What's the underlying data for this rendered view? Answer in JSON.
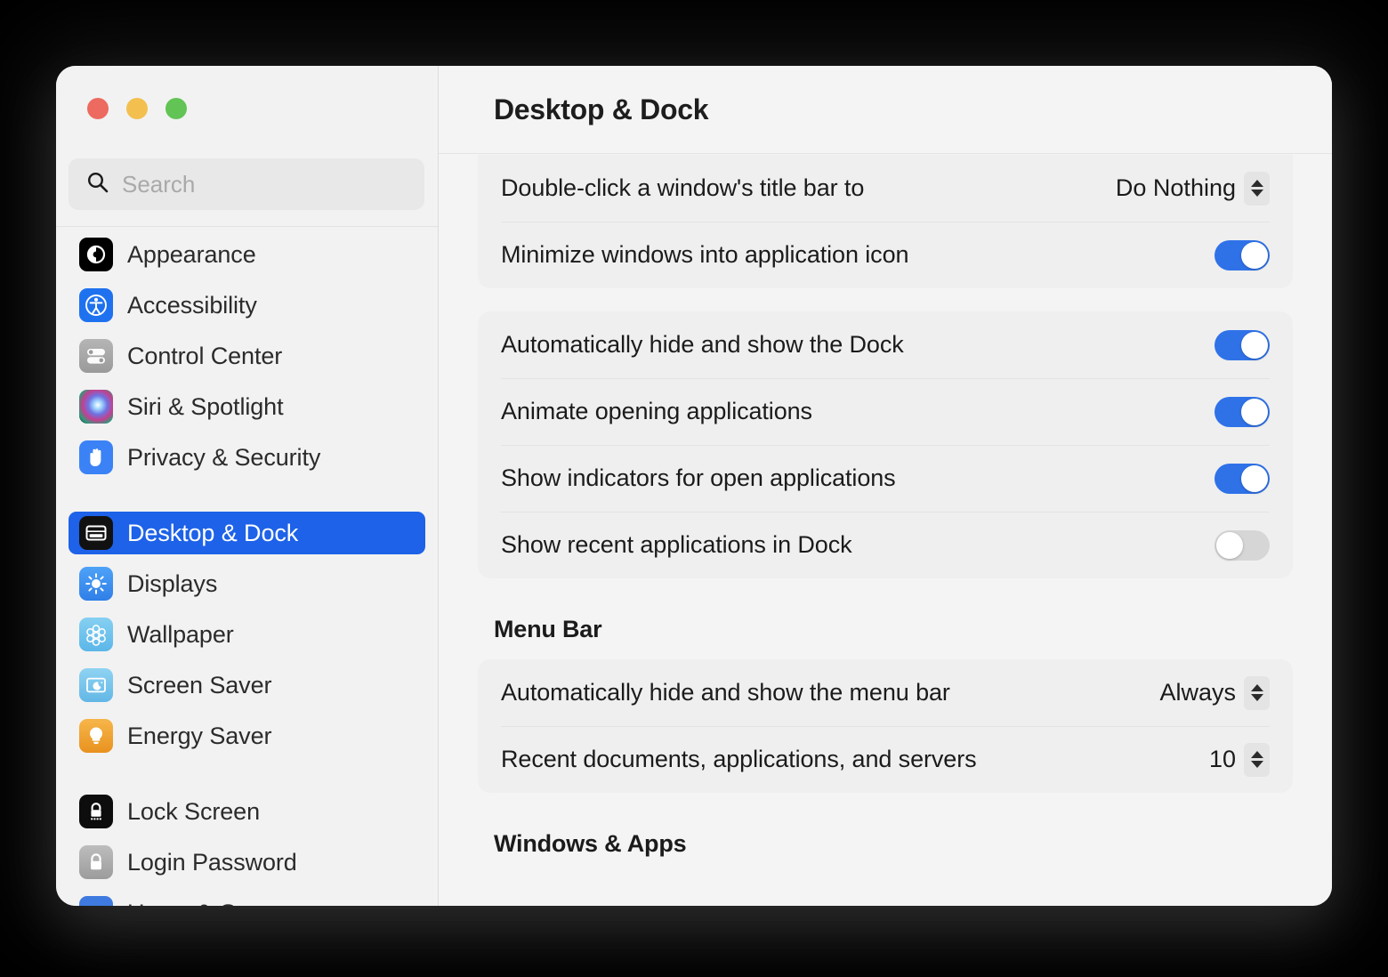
{
  "window": {
    "traffic_lights": [
      {
        "name": "close",
        "color": "#ec6a5f"
      },
      {
        "name": "minimize",
        "color": "#f3bf4f"
      },
      {
        "name": "zoom",
        "color": "#61c454"
      }
    ]
  },
  "search": {
    "placeholder": "Search",
    "value": ""
  },
  "sidebar": {
    "groups": [
      {
        "items": [
          {
            "label": "Appearance",
            "icon": "appearance-icon"
          },
          {
            "label": "Accessibility",
            "icon": "accessibility-icon"
          },
          {
            "label": "Control Center",
            "icon": "control-center-icon"
          },
          {
            "label": "Siri & Spotlight",
            "icon": "siri-icon"
          },
          {
            "label": "Privacy & Security",
            "icon": "privacy-icon"
          }
        ]
      },
      {
        "items": [
          {
            "label": "Desktop & Dock",
            "icon": "desktop-dock-icon",
            "selected": true
          },
          {
            "label": "Displays",
            "icon": "displays-icon"
          },
          {
            "label": "Wallpaper",
            "icon": "wallpaper-icon"
          },
          {
            "label": "Screen Saver",
            "icon": "screen-saver-icon"
          },
          {
            "label": "Energy Saver",
            "icon": "energy-saver-icon"
          }
        ]
      },
      {
        "items": [
          {
            "label": "Lock Screen",
            "icon": "lock-screen-icon"
          },
          {
            "label": "Login Password",
            "icon": "login-password-icon"
          },
          {
            "label": "Users & Groups",
            "icon": "users-groups-icon"
          }
        ]
      }
    ]
  },
  "main": {
    "title": "Desktop & Dock",
    "group1": {
      "rows": [
        {
          "label": "Double-click a window's title bar to",
          "control": "popup",
          "value": "Do Nothing"
        },
        {
          "label": "Minimize windows into application icon",
          "control": "toggle",
          "value": "on"
        }
      ]
    },
    "group2": {
      "rows": [
        {
          "label": "Automatically hide and show the Dock",
          "control": "toggle",
          "value": "on"
        },
        {
          "label": "Animate opening applications",
          "control": "toggle",
          "value": "on"
        },
        {
          "label": "Show indicators for open applications",
          "control": "toggle",
          "value": "on"
        },
        {
          "label": "Show recent applications in Dock",
          "control": "toggle",
          "value": "off"
        }
      ]
    },
    "menu_bar_section": {
      "title": "Menu Bar",
      "rows": [
        {
          "label": "Automatically hide and show the menu bar",
          "control": "popup",
          "value": "Always"
        },
        {
          "label": "Recent documents, applications, and servers",
          "control": "popup",
          "value": "10"
        }
      ]
    },
    "windows_apps_section": {
      "title": "Windows & Apps"
    }
  },
  "colors": {
    "accent": "#1d62e8",
    "toggle_on": "#2f72e8",
    "toggle_off": "#d6d6d6",
    "window_bg": "#f4f4f4",
    "card_bg": "#efefef"
  }
}
